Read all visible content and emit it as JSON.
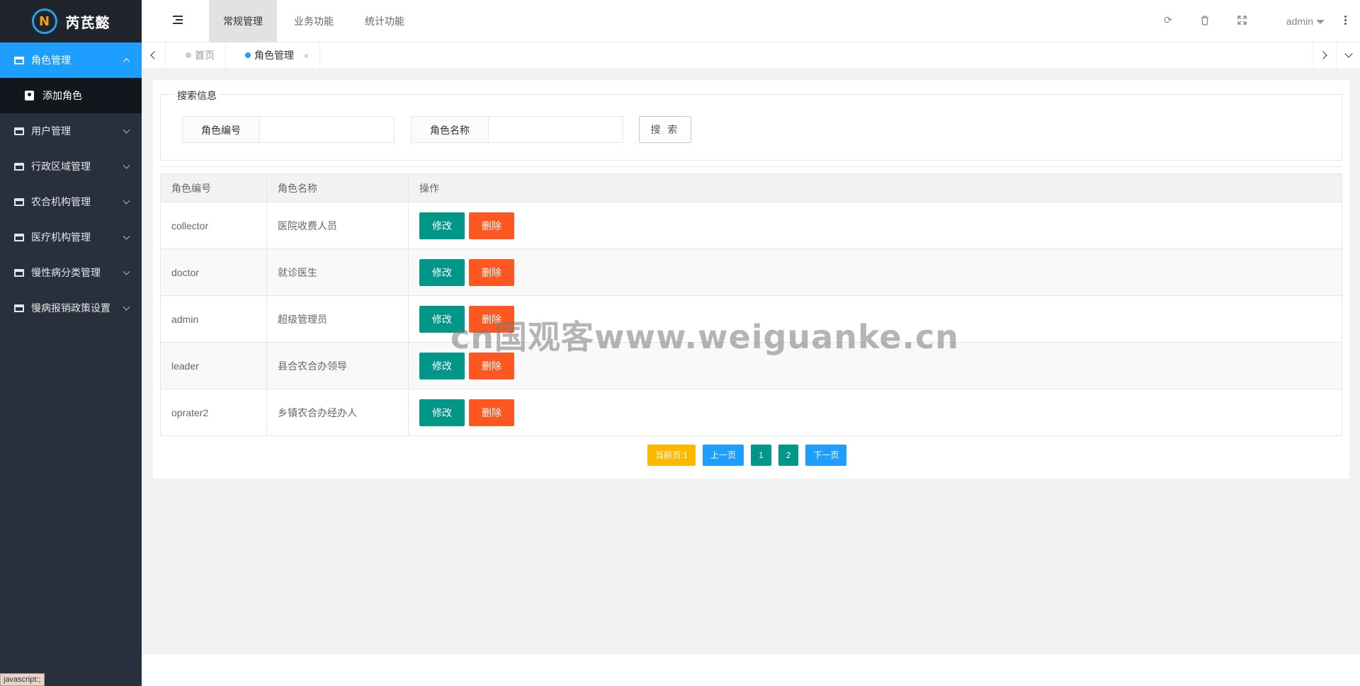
{
  "app": {
    "logo_mark": "N",
    "logo_name": "芮芪懿"
  },
  "sidebar": {
    "items": [
      {
        "label": "角色管理",
        "active": true
      },
      {
        "label": "用户管理"
      },
      {
        "label": "行政区域管理"
      },
      {
        "label": "农合机构管理"
      },
      {
        "label": "医疗机构管理"
      },
      {
        "label": "慢性病分类管理"
      },
      {
        "label": "慢病报销政策设置"
      }
    ],
    "sub_item": "添加角色"
  },
  "header": {
    "tabs": [
      "常规管理",
      "业务功能",
      "统计功能"
    ],
    "user": "admin",
    "icons": [
      "refresh-icon",
      "trash-icon",
      "fullscreen-icon"
    ]
  },
  "page_tabs": [
    {
      "label": "首页"
    },
    {
      "label": "角色管理",
      "close": "×"
    }
  ],
  "search": {
    "legend": "搜索信息",
    "role_id_label": "角色编号",
    "role_name_label": "角色名称",
    "role_id_value": "",
    "role_name_value": "",
    "button": "搜 索"
  },
  "table": {
    "headers": [
      "角色编号",
      "角色名称",
      "操作"
    ],
    "rows": [
      {
        "id": "collector",
        "name": "医院收费人员"
      },
      {
        "id": "doctor",
        "name": "就诊医生"
      },
      {
        "id": "admin",
        "name": "超级管理员"
      },
      {
        "id": "leader",
        "name": "县合农合办领导"
      },
      {
        "id": "oprater2",
        "name": "乡镇农合办经办人"
      }
    ],
    "edit_label": "修改",
    "delete_label": "删除"
  },
  "pager": {
    "current": "当前页:1",
    "prev": "上一页",
    "pages": [
      "1",
      "2"
    ],
    "next": "下一页"
  },
  "watermark": "cn国观客www.weiguanke.cn",
  "status_tip": "javascript:;",
  "colors": {
    "primary": "#1e9fff",
    "green": "#009688",
    "orange": "#ff5722",
    "yellow": "#ffb800",
    "sidebar": "#28303d"
  }
}
